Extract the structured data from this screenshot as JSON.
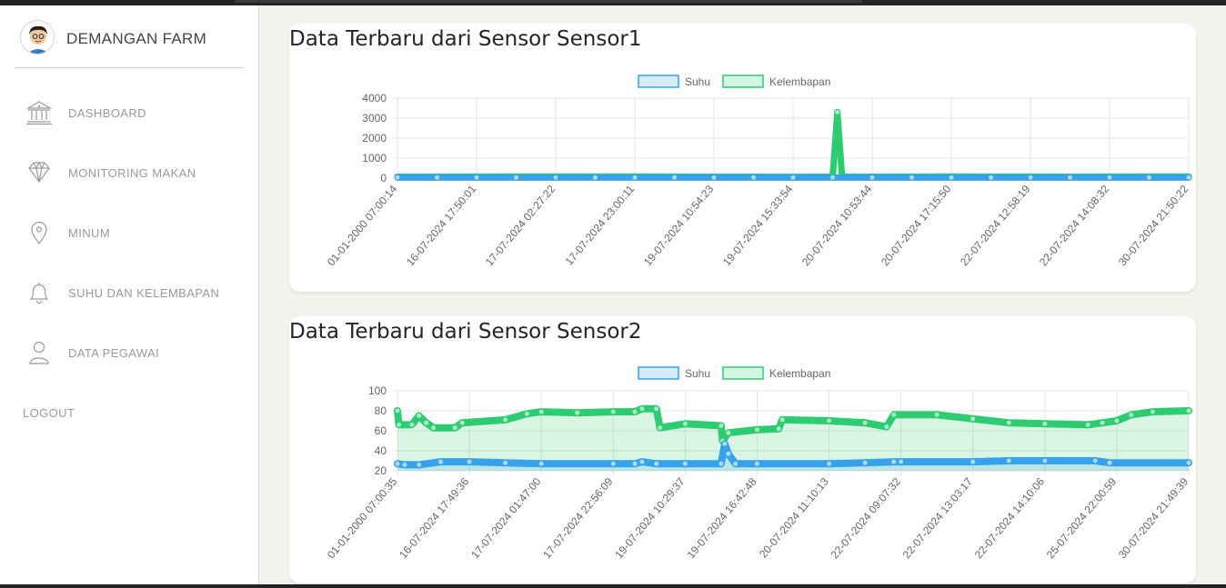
{
  "brand": {
    "name": "DEMANGAN FARM"
  },
  "nav": [
    {
      "label": "DASHBOARD",
      "icon": "bank-icon"
    },
    {
      "label": "MONITORING MAKAN",
      "icon": "diamond-icon"
    },
    {
      "label": "MINUM",
      "icon": "location-pin-icon"
    },
    {
      "label": "SUHU DAN KELEMBAPAN",
      "icon": "bell-icon"
    },
    {
      "label": "DATA PEGAWAI",
      "icon": "user-icon"
    }
  ],
  "logout_label": "LOGOUT",
  "colors": {
    "suhu": "#36a2eb",
    "kelembapan": "#2ecc71",
    "grid": "#e5e5e5"
  },
  "chart_data": [
    {
      "type": "line",
      "title": "Data Terbaru dari Sensor Sensor1",
      "legend": [
        "Suhu",
        "Kelembapan"
      ],
      "legend_position": "top",
      "ylim": [
        0,
        4000
      ],
      "yticks": [
        0,
        1000,
        2000,
        3000,
        4000
      ],
      "x_tick_labels": [
        "01-01-2000 07:00:14",
        "16-07-2024 17:50:01",
        "17-07-2024 02:27:22",
        "17-07-2024 23:00:11",
        "19-07-2024 10:54:23",
        "19-07-2024 15:33:54",
        "20-07-2024 10:53:44",
        "20-07-2024 17:15:50",
        "22-07-2024 12:58:19",
        "22-07-2024 14:08:32",
        "30-07-2024 21:50:22"
      ],
      "series": [
        {
          "name": "Suhu",
          "points": [
            [
              0,
              28
            ],
            [
              0.5,
              28
            ],
            [
              1,
              28
            ],
            [
              1.5,
              28
            ],
            [
              2,
              28
            ],
            [
              2.5,
              28
            ],
            [
              3,
              28
            ],
            [
              3.5,
              28
            ],
            [
              4,
              28
            ],
            [
              4.5,
              28
            ],
            [
              5,
              28
            ],
            [
              5.5,
              28
            ],
            [
              6,
              28
            ],
            [
              6.5,
              28
            ],
            [
              7,
              28
            ],
            [
              7.5,
              28
            ],
            [
              8,
              28
            ],
            [
              8.5,
              28
            ],
            [
              9,
              28
            ],
            [
              9.5,
              28
            ],
            [
              10,
              28
            ]
          ]
        },
        {
          "name": "Kelembapan",
          "points": [
            [
              0,
              70
            ],
            [
              0.5,
              70
            ],
            [
              1,
              72
            ],
            [
              1.5,
              75
            ],
            [
              2,
              78
            ],
            [
              2.5,
              78
            ],
            [
              3,
              75
            ],
            [
              3.5,
              72
            ],
            [
              4,
              70
            ],
            [
              4.5,
              68
            ],
            [
              5,
              65
            ],
            [
              5.5,
              68
            ],
            [
              5.56,
              3300
            ],
            [
              5.62,
              68
            ],
            [
              6,
              70
            ],
            [
              6.5,
              72
            ],
            [
              7,
              75
            ],
            [
              7.5,
              74
            ],
            [
              8,
              72
            ],
            [
              8.5,
              70
            ],
            [
              9,
              72
            ],
            [
              9.5,
              78
            ],
            [
              10,
              80
            ]
          ]
        }
      ]
    },
    {
      "type": "line",
      "title": "Data Terbaru dari Sensor Sensor2",
      "legend": [
        "Suhu",
        "Kelembapan"
      ],
      "legend_position": "top",
      "ylim": [
        20,
        100
      ],
      "yticks": [
        20,
        40,
        60,
        80,
        100
      ],
      "x_tick_labels": [
        "01-01-2000 07:00:35",
        "16-07-2024 17:49:36",
        "17-07-2024 01:47:00",
        "17-07-2024 22:56:09",
        "19-07-2024 10:29:37",
        "19-07-2024 16:42:48",
        "20-07-2024 11:10:13",
        "22-07-2024 09:07:32",
        "22-07-2024 13:03:17",
        "22-07-2024 14:10:06",
        "25-07-2024 22:00:59",
        "30-07-2024 21:49:39"
      ],
      "series": [
        {
          "name": "Suhu",
          "points": [
            [
              0,
              27
            ],
            [
              0.1,
              26
            ],
            [
              0.3,
              26
            ],
            [
              0.6,
              29
            ],
            [
              1,
              29
            ],
            [
              1.5,
              28
            ],
            [
              2,
              27
            ],
            [
              3,
              27
            ],
            [
              3.3,
              27
            ],
            [
              3.4,
              29
            ],
            [
              3.6,
              27
            ],
            [
              4,
              27
            ],
            [
              4.5,
              27
            ],
            [
              4.55,
              47
            ],
            [
              4.6,
              37
            ],
            [
              4.7,
              27
            ],
            [
              5,
              27
            ],
            [
              6,
              27
            ],
            [
              6.5,
              28
            ],
            [
              6.9,
              29
            ],
            [
              7,
              29
            ],
            [
              8,
              29
            ],
            [
              8.5,
              30
            ],
            [
              9,
              30
            ],
            [
              9.7,
              30
            ],
            [
              9.9,
              28
            ],
            [
              11,
              28
            ]
          ]
        },
        {
          "name": "Kelembapan",
          "points": [
            [
              0,
              80
            ],
            [
              0.02,
              66
            ],
            [
              0.2,
              66
            ],
            [
              0.3,
              75
            ],
            [
              0.4,
              68
            ],
            [
              0.5,
              63
            ],
            [
              0.8,
              63
            ],
            [
              0.9,
              68
            ],
            [
              1.5,
              71
            ],
            [
              1.8,
              77
            ],
            [
              2,
              79
            ],
            [
              2.5,
              78
            ],
            [
              3,
              79
            ],
            [
              3.3,
              79
            ],
            [
              3.4,
              82
            ],
            [
              3.6,
              82
            ],
            [
              3.65,
              63
            ],
            [
              4,
              67
            ],
            [
              4.5,
              65
            ],
            [
              4.52,
              50
            ],
            [
              4.6,
              58
            ],
            [
              5,
              61
            ],
            [
              5.3,
              62
            ],
            [
              5.35,
              71
            ],
            [
              6,
              70
            ],
            [
              6.5,
              68
            ],
            [
              6.8,
              64
            ],
            [
              6.9,
              76
            ],
            [
              7.5,
              76
            ],
            [
              8,
              72
            ],
            [
              8.5,
              68
            ],
            [
              9,
              67
            ],
            [
              9.6,
              66
            ],
            [
              9.8,
              68
            ],
            [
              10,
              70
            ],
            [
              10.2,
              76
            ],
            [
              10.5,
              79
            ],
            [
              11,
              80
            ]
          ]
        }
      ]
    }
  ]
}
